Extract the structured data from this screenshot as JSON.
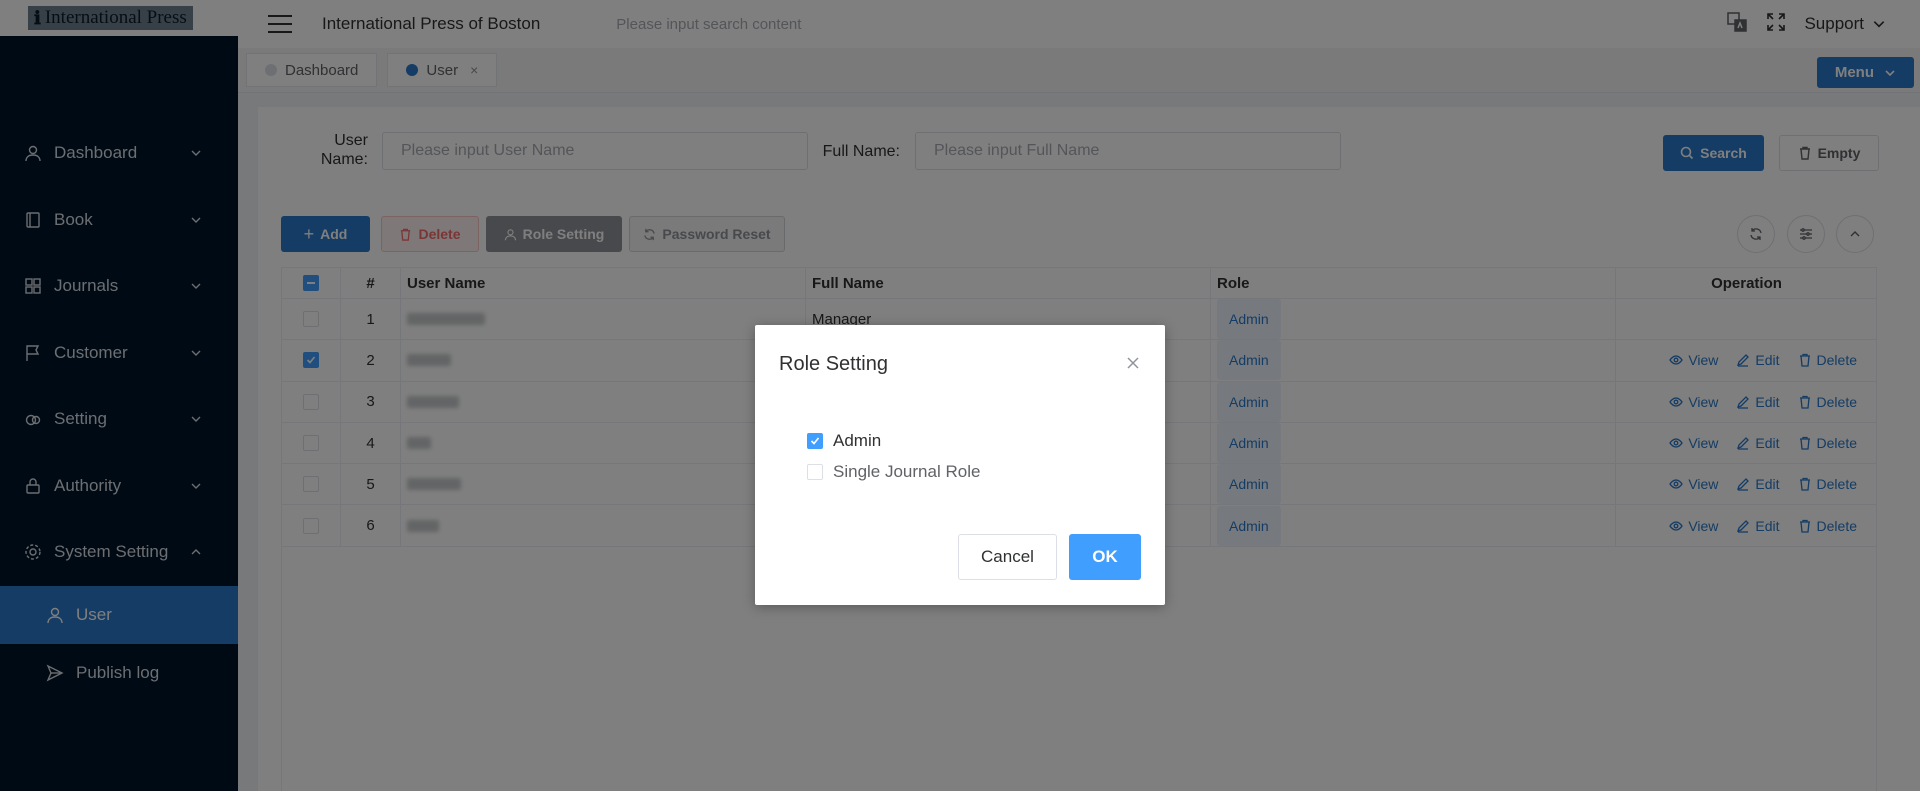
{
  "logo": {
    "text": "International Press"
  },
  "sidebar": {
    "items": [
      {
        "label": "Dashboard",
        "icon": "user-icon"
      },
      {
        "label": "Book",
        "icon": "book-icon"
      },
      {
        "label": "Journals",
        "icon": "grid-icon"
      },
      {
        "label": "Customer",
        "icon": "flag-icon"
      },
      {
        "label": "Setting",
        "icon": "cloud-icon"
      },
      {
        "label": "Authority",
        "icon": "lock-icon"
      },
      {
        "label": "System Setting",
        "icon": "gear-icon"
      }
    ],
    "sub_items": [
      {
        "label": "User",
        "icon": "user-icon",
        "active": true
      },
      {
        "label": "Publish log",
        "icon": "send-icon"
      }
    ]
  },
  "header": {
    "title": "International Press of Boston",
    "search_placeholder": "Please input search content",
    "support_label": "Support"
  },
  "tabs": [
    {
      "label": "Dashboard",
      "active": false
    },
    {
      "label": "User",
      "active": true,
      "close": "×"
    }
  ],
  "menu_button": "Menu",
  "filters": {
    "user_name_label": "User Name:",
    "user_name_placeholder": "Please input User Name",
    "full_name_label": "Full Name:",
    "full_name_placeholder": "Please input Full Name",
    "search_label": "Search",
    "empty_label": "Empty"
  },
  "toolbar": {
    "add_label": "Add",
    "delete_label": "Delete",
    "role_setting_label": "Role Setting",
    "password_reset_label": "Password Reset"
  },
  "table": {
    "headers": {
      "num": "#",
      "user_name": "User Name",
      "full_name": "Full Name",
      "role": "Role",
      "operation": "Operation"
    },
    "rows": [
      {
        "num": "1",
        "full_name": "Manager",
        "role": "Admin",
        "checked": false,
        "ops": false
      },
      {
        "num": "2",
        "full_name": "",
        "role": "Admin",
        "checked": true,
        "ops": true
      },
      {
        "num": "3",
        "full_name": "",
        "role": "Admin",
        "checked": false,
        "ops": true
      },
      {
        "num": "4",
        "full_name": "",
        "role": "Admin",
        "checked": false,
        "ops": true
      },
      {
        "num": "5",
        "full_name": "",
        "role": "Admin",
        "checked": false,
        "ops": true
      },
      {
        "num": "6",
        "full_name": "",
        "role": "Admin",
        "checked": false,
        "ops": true
      }
    ],
    "op_labels": {
      "view": "View",
      "edit": "Edit",
      "delete": "Delete"
    }
  },
  "dialog": {
    "title": "Role Setting",
    "options": [
      {
        "label": "Admin",
        "checked": true
      },
      {
        "label": "Single Journal Role",
        "checked": false
      }
    ],
    "cancel_label": "Cancel",
    "ok_label": "OK"
  },
  "colors": {
    "sidebar_bg": "#001529",
    "primary": "#2b78c8",
    "checkbox": "#409eff"
  }
}
